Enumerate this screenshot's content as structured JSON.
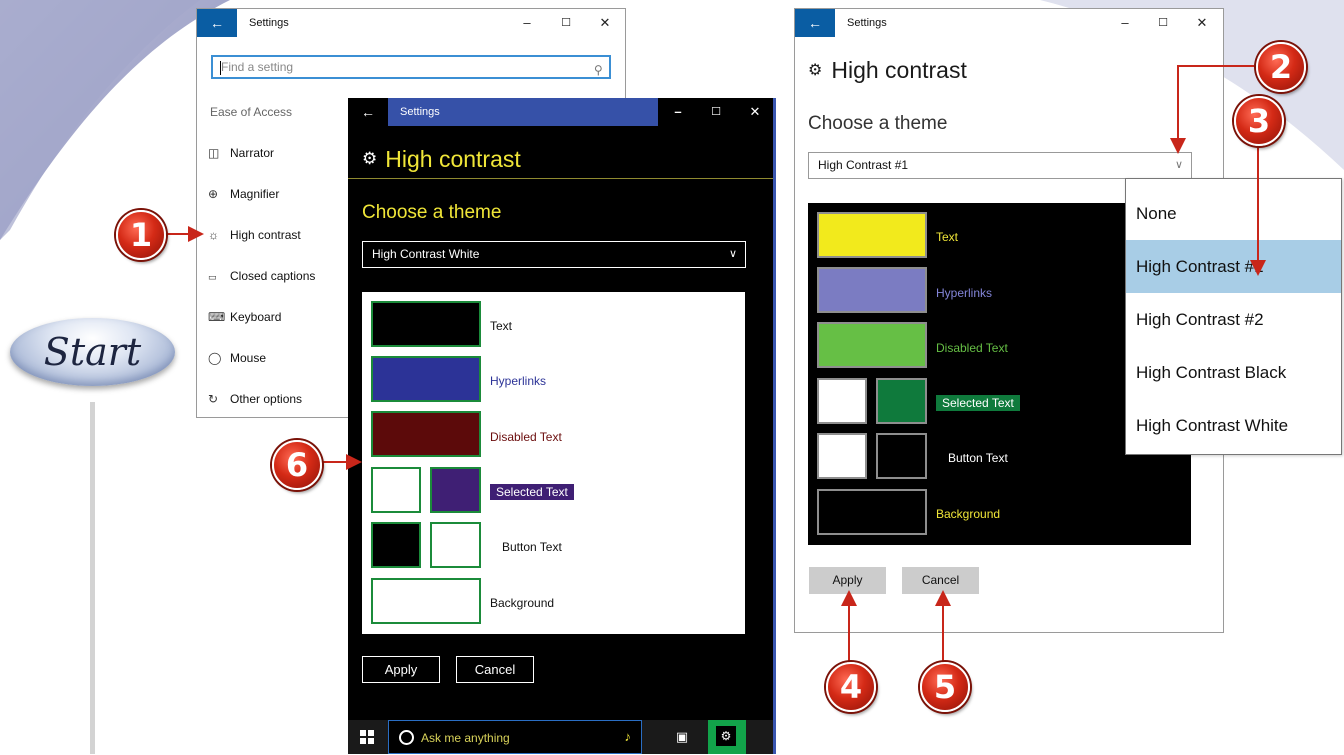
{
  "start": {
    "label": "Start"
  },
  "settings_window": {
    "title": "Settings",
    "search_placeholder": "Find a setting",
    "section_label": "Ease of Access",
    "nav_items": [
      "Narrator",
      "Magnifier",
      "High contrast",
      "Closed captions",
      "Keyboard",
      "Mouse",
      "Other options"
    ],
    "controls": [
      "–",
      "☐",
      "✕"
    ]
  },
  "dark_window": {
    "title": "Settings",
    "heading": "High contrast",
    "choose_label": "Choose a theme",
    "selected_theme": "High Contrast White",
    "preview_labels": [
      "Text",
      "Hyperlinks",
      "Disabled Text",
      "Selected Text",
      "Button Text",
      "Background"
    ],
    "apply_label": "Apply",
    "cancel_label": "Cancel",
    "taskbar_search": "Ask me anything",
    "controls": [
      "–",
      "☐",
      "✕"
    ]
  },
  "light_window": {
    "title": "Settings",
    "heading": "High contrast",
    "choose_label": "Choose a theme",
    "selected_theme": "High Contrast #1",
    "preview_labels": [
      "Text",
      "Hyperlinks",
      "Disabled Text",
      "Selected Text",
      "Button Text",
      "Background"
    ],
    "apply_label": "Apply",
    "cancel_label": "Cancel",
    "controls": [
      "–",
      "☐",
      "✕"
    ]
  },
  "theme_dropdown": {
    "options": [
      "None",
      "High Contrast #1",
      "High Contrast #2",
      "High Contrast Black",
      "High Contrast White"
    ],
    "selected": "High Contrast #1"
  },
  "callouts": [
    "1",
    "2",
    "3",
    "4",
    "5",
    "6"
  ],
  "colors": {
    "accent_blue": "#0a5da3",
    "hc_yellow": "#f0e638",
    "hc_green": "#1b8b3a",
    "callout_red": "#c8261a",
    "dropdown_selected": "#a8cde6"
  }
}
